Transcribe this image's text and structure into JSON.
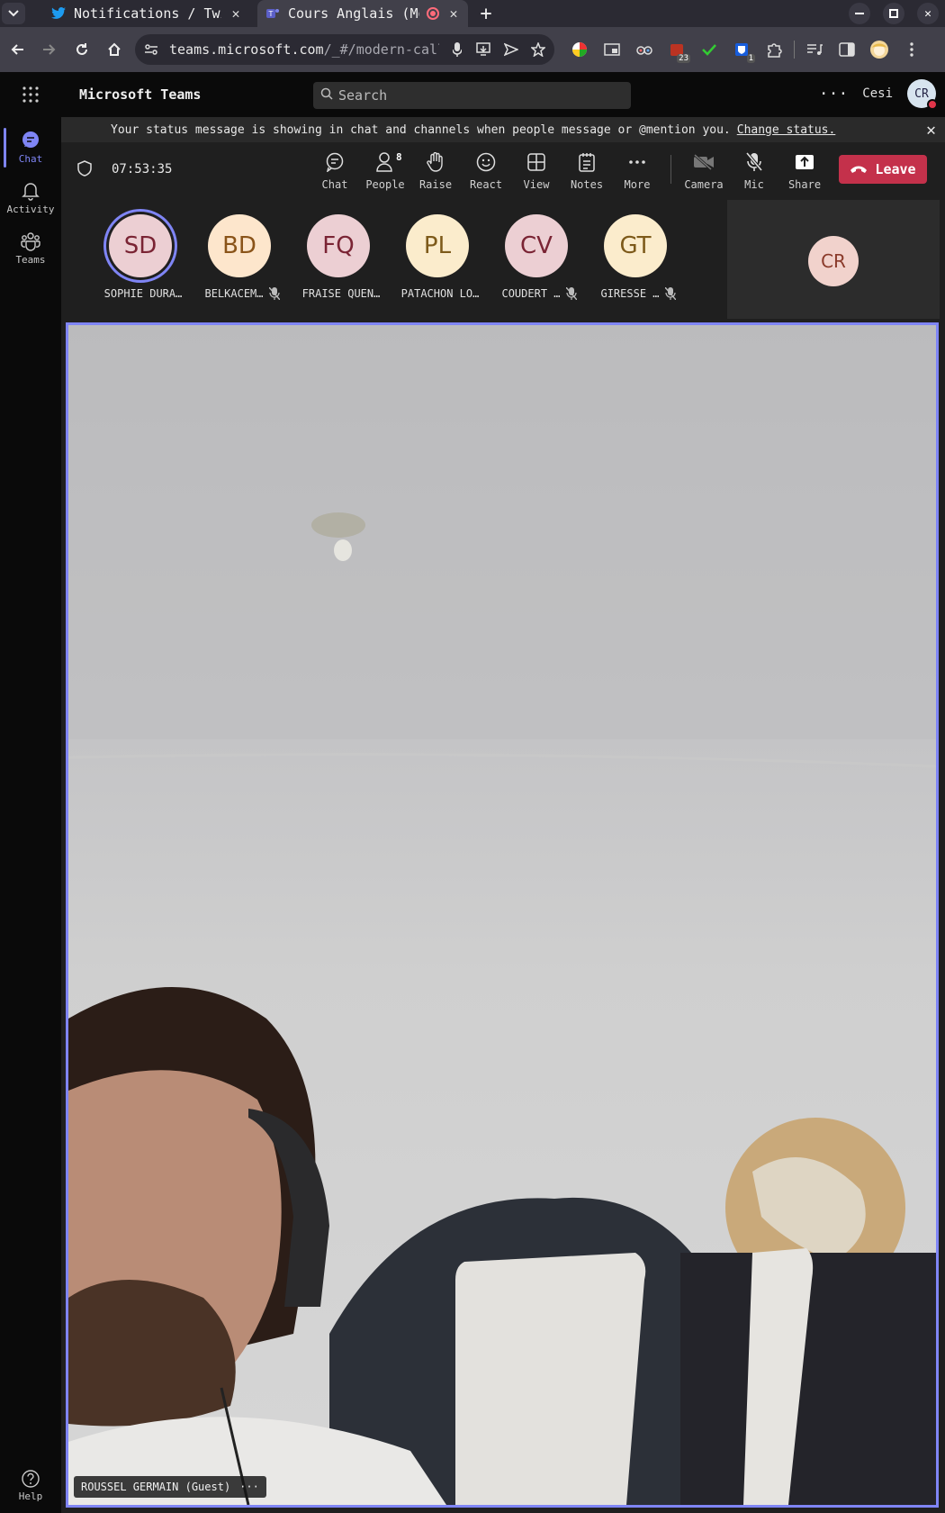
{
  "browser": {
    "tabs": [
      {
        "title": "Notifications / Twi",
        "icon": "twitter-icon"
      },
      {
        "title": "Cours Anglais (Mo",
        "icon": "teams-icon",
        "recording": true
      }
    ],
    "url_host": "teams.microsoft.com",
    "url_path": "/_#/modern-callin…",
    "ext_badges": {
      "calendar": "23",
      "bitwarden": "1"
    }
  },
  "teams": {
    "app_title": "Microsoft Teams",
    "search_placeholder": "Search",
    "org": "Cesi",
    "user_initials": "CR"
  },
  "rail": [
    {
      "label": "Chat",
      "icon": "chat-icon",
      "active": true
    },
    {
      "label": "Activity",
      "icon": "bell-icon"
    },
    {
      "label": "Teams",
      "icon": "teams-people-icon"
    }
  ],
  "help_label": "Help",
  "status": {
    "message": "Your status message is showing in chat and channels when people message or @mention you.",
    "link": "Change status."
  },
  "meeting": {
    "timer": "07:53:35",
    "controls": {
      "chat": "Chat",
      "people": "People",
      "people_count": "8",
      "raise": "Raise",
      "react": "React",
      "view": "View",
      "notes": "Notes",
      "more": "More",
      "camera": "Camera",
      "mic": "Mic",
      "share": "Share",
      "leave": "Leave"
    },
    "participants": [
      {
        "initials": "SD",
        "name": "SOPHIE DURA…",
        "muted": false,
        "speaking": true,
        "bg": "#eccfd3",
        "fg": "#7a2434"
      },
      {
        "initials": "BD",
        "name": "BELKACEM…",
        "muted": true,
        "bg": "#fde6cc",
        "fg": "#8a5419"
      },
      {
        "initials": "FQ",
        "name": "FRAISE QUEN…",
        "muted": false,
        "bg": "#eccfd3",
        "fg": "#7a2434"
      },
      {
        "initials": "PL",
        "name": "PATACHON LO…",
        "muted": false,
        "bg": "#fbeccc",
        "fg": "#7d5a1a"
      },
      {
        "initials": "CV",
        "name": "COUDERT …",
        "muted": true,
        "bg": "#eccfd3",
        "fg": "#7a2434"
      },
      {
        "initials": "GT",
        "name": "GIRESSE …",
        "muted": true,
        "bg": "#fbeccc",
        "fg": "#7d5a1a"
      }
    ],
    "self_initials": "CR",
    "video_name": "ROUSSEL GERMAIN (Guest)"
  }
}
